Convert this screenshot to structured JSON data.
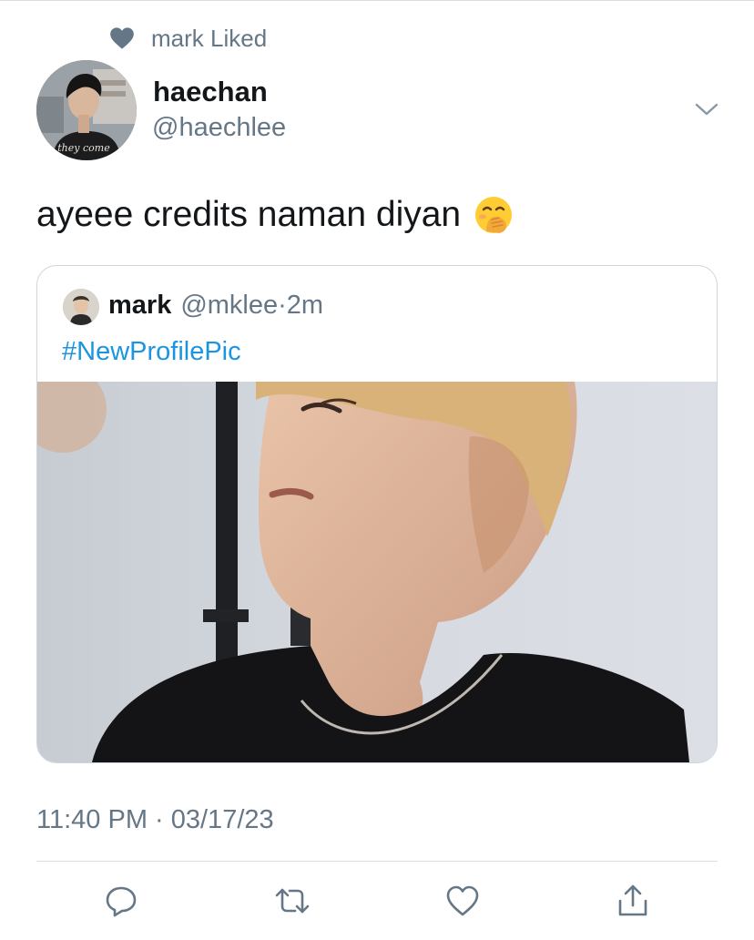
{
  "social_context": {
    "text": "mark Liked",
    "icon": "heart-icon"
  },
  "tweet": {
    "author": {
      "display_name": "haechan",
      "handle": "@haechlee",
      "avatar_shirt_text": "they come"
    },
    "text": "ayeee credits naman diyan",
    "emoji": "hand-over-mouth-emoji",
    "timestamp": "11:40 PM · 03/17/23"
  },
  "quoted_tweet": {
    "display_name": "mark",
    "handle": "@mklee",
    "separator": "·",
    "age": "2m",
    "text": "#NewProfilePic",
    "media": "photo"
  },
  "actions": [
    {
      "name": "reply",
      "icon": "reply-icon"
    },
    {
      "name": "retweet",
      "icon": "retweet-icon"
    },
    {
      "name": "like",
      "icon": "heart-outline-icon"
    },
    {
      "name": "share",
      "icon": "share-icon"
    }
  ],
  "colors": {
    "text_primary": "#14171a",
    "text_secondary": "#657786",
    "link": "#1b95e0",
    "border": "#ccd6dd"
  }
}
